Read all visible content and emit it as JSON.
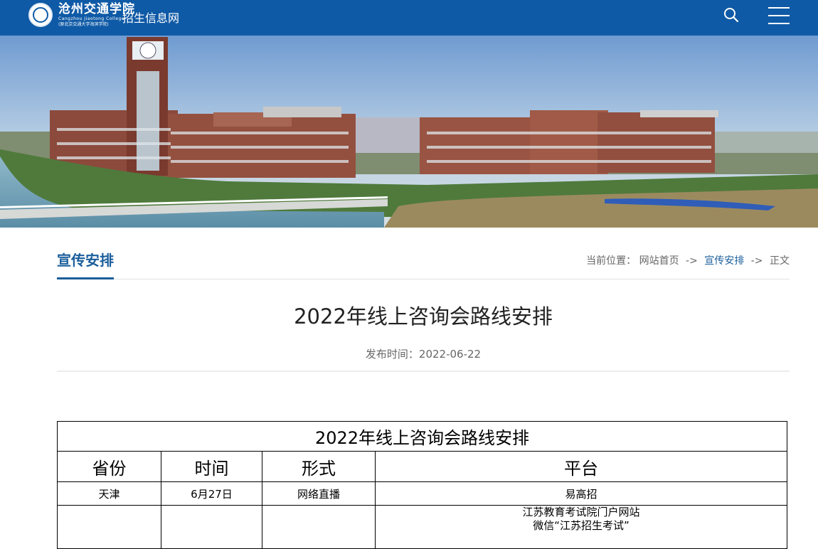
{
  "header": {
    "logo_cn": "沧州交通学院",
    "logo_en": "Cangzhou Jiaotong College",
    "logo_sub": "(原北京交通大学海滨学院)",
    "site_name": "招生信息网",
    "colors": {
      "bar": "#0f5aa6"
    },
    "icons": [
      "search-icon",
      "menu-icon"
    ]
  },
  "section": {
    "title": "宣传安排",
    "breadcrumb": {
      "prefix": "当前位置：",
      "items": [
        "网站首页",
        "宣传安排",
        "正文"
      ],
      "separator": "->"
    },
    "accent": "#1b5e9b"
  },
  "article": {
    "title": "2022年线上咨询会路线安排",
    "date": "发布时间：2022-06-22"
  },
  "table": {
    "caption": "2022年线上咨询会路线安排",
    "columns": [
      "省份",
      "时间",
      "形式",
      "平台"
    ],
    "rows": [
      {
        "province": "天津",
        "time": "6月27日",
        "form": "网络直播",
        "platform": [
          "易高招"
        ]
      },
      {
        "province": "",
        "time": "",
        "form": "",
        "platform": [
          "江苏教育考试院门户网站",
          "微信“江苏招生考试”"
        ]
      }
    ]
  }
}
